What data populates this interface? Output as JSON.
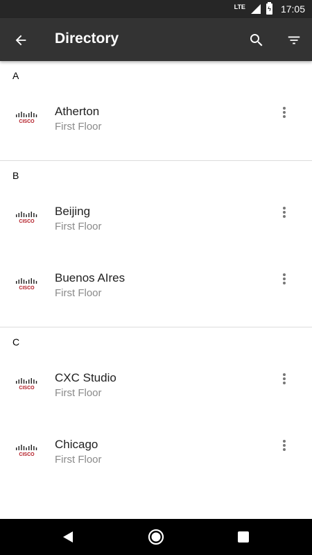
{
  "status_bar": {
    "network": "LTE",
    "battery_glyph": "ϟ",
    "time": "17:05"
  },
  "app_bar": {
    "title": "Directory",
    "icons": [
      "back-arrow-icon",
      "search-icon",
      "filter-icon"
    ]
  },
  "sections": [
    {
      "letter": "A",
      "items": [
        {
          "title": "Atherton",
          "subtitle": "First Floor"
        }
      ]
    },
    {
      "letter": "B",
      "items": [
        {
          "title": "Beijing",
          "subtitle": "First Floor"
        },
        {
          "title": "Buenos AIres",
          "subtitle": "First Floor"
        }
      ]
    },
    {
      "letter": "C",
      "items": [
        {
          "title": "CXC Studio",
          "subtitle": "First Floor"
        },
        {
          "title": "Chicago",
          "subtitle": "First Floor"
        }
      ]
    }
  ],
  "logo": {
    "text": "CISCO",
    "bar_color": "#1b1b1b",
    "text_color": "#b0141e"
  },
  "colors": {
    "app_bar": "#333333",
    "status_bar": "#262626",
    "subtitle": "#8a8a8a",
    "divider": "#dcdcdc"
  }
}
